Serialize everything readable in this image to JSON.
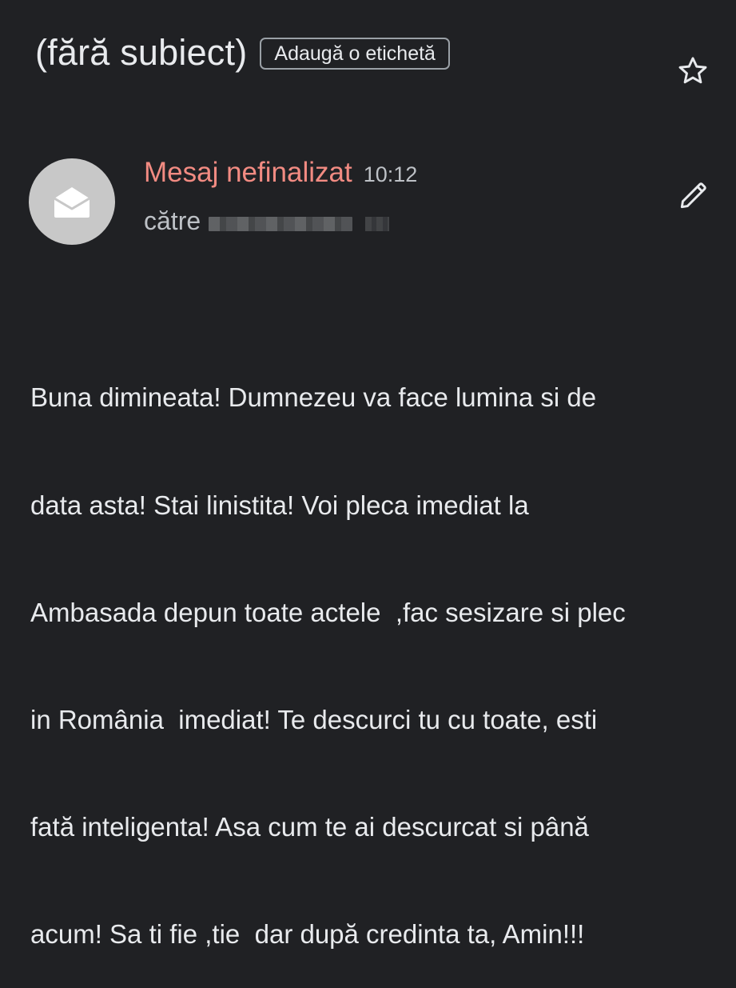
{
  "header": {
    "subject": "(fără subiect)",
    "add_label_chip": "Adaugă o etichetă",
    "star_icon": "star-outline-icon"
  },
  "message": {
    "avatar_icon": "envelope-open-icon",
    "sender": "Mesaj nefinalizat",
    "time": "10:12",
    "to_label": "către",
    "edit_icon": "pencil-icon",
    "body_lines": [
      "Buna dimineata! Dumnezeu va face lumina si de",
      "data asta! Stai linistita! Voi pleca imediat la",
      "Ambasada depun toate actele  ,fac sesizare si plec",
      "in România  imediat! Te descurci tu cu toate, esti",
      "fată inteligenta! Asa cum te ai descurcat si până",
      "acum! Sa ti fie ,tie  dar după credinta ta, Amin!!!"
    ]
  },
  "colors": {
    "background": "#202124",
    "sender_red": "#f28b82",
    "text": "#e8eaed",
    "secondary_text": "#bdc1c6",
    "avatar_bg": "#c8c8c8"
  }
}
